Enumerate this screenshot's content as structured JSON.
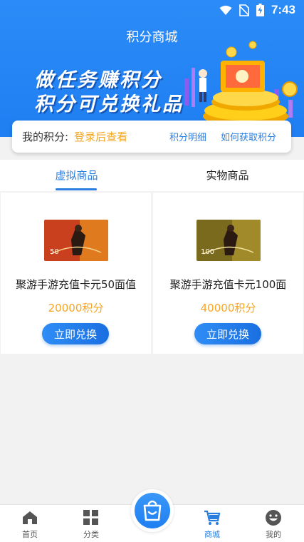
{
  "status": {
    "time": "7:43"
  },
  "header": {
    "title": "积分商城"
  },
  "banner": {
    "line1": "做任务赚积分",
    "line2": "积分可兑换礼品"
  },
  "points": {
    "label": "我的积分:",
    "value": "登录后查看",
    "detail_link": "积分明细",
    "how_link": "如何获取积分"
  },
  "tabs": [
    {
      "label": "虚拟商品",
      "active": true
    },
    {
      "label": "实物商品",
      "active": false
    }
  ],
  "products": [
    {
      "card_value": "50",
      "name": "聚游手游充值卡元50面值",
      "price": "20000积分",
      "button": "立即兑换"
    },
    {
      "card_value": "100",
      "name": "聚游手游充值卡元100面",
      "price": "40000积分",
      "button": "立即兑换"
    }
  ],
  "nav": [
    {
      "label": "首页",
      "icon": "home-icon"
    },
    {
      "label": "分类",
      "icon": "grid-icon"
    },
    {
      "label": "商城",
      "icon": "cart-icon",
      "active": true
    },
    {
      "label": "我的",
      "icon": "smiley-icon"
    }
  ],
  "colors": {
    "primary": "#2a7ee0",
    "accent": "#f5a623"
  }
}
